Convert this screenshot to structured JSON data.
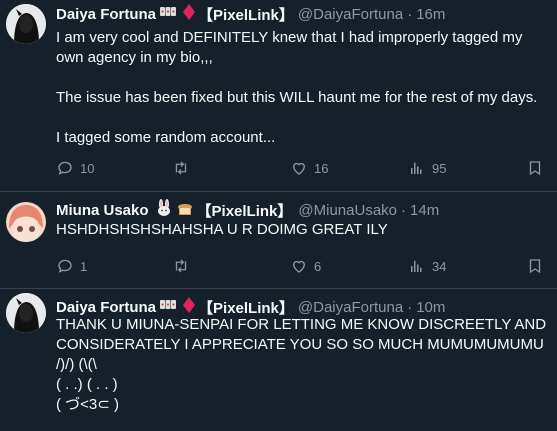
{
  "tweets": [
    {
      "name": "Daiya Fortuna",
      "tag": "【PixelLink】",
      "handle": "@DaiyaFortuna",
      "sep": "·",
      "time": "16m",
      "lines": [
        "I am very cool and DEFINITELY knew that I had improperly tagged my own agency in my bio,,,",
        "The issue has been fixed but this WILL haunt me for the rest of my days.",
        "I tagged some random account..."
      ],
      "replies": "10",
      "retweets": "",
      "likes": "16",
      "views": "95"
    },
    {
      "name": "Miuna Usako",
      "tag": "【PixelLink】",
      "handle": "@MiunaUsako",
      "sep": "·",
      "time": "14m",
      "lines": [
        "HSHDHSHSHSHAHSHA U R DOIMG GREAT ILY"
      ],
      "replies": "1",
      "retweets": "",
      "likes": "6",
      "views": "34"
    },
    {
      "name": "Daiya Fortuna",
      "tag": "【PixelLink】",
      "handle": "@DaiyaFortuna",
      "sep": "·",
      "time": "10m",
      "lines": [
        "THANK U MIUNA-SENPAI FOR LETTING ME KNOW DISCREETLY AND CONSIDERATELY I APPRECIATE YOU SO SO MUCH MUMUMUMUMU",
        "/)/) (\\(\\",
        "( . .)  ( . . )",
        "( づ<3⊂ )"
      ]
    }
  ],
  "colors": {
    "background": "#15202b",
    "text": "#f7f9f9",
    "secondary": "#8b98a5",
    "divider": "#38444d",
    "diamond": "#e0245e"
  },
  "icons": [
    "reply-icon",
    "retweet-icon",
    "like-icon",
    "views-icon",
    "bookmark-icon",
    "dice-emoji-icon",
    "diamond-emoji-icon",
    "rabbit-emoji-icon",
    "bread-emoji-icon"
  ]
}
